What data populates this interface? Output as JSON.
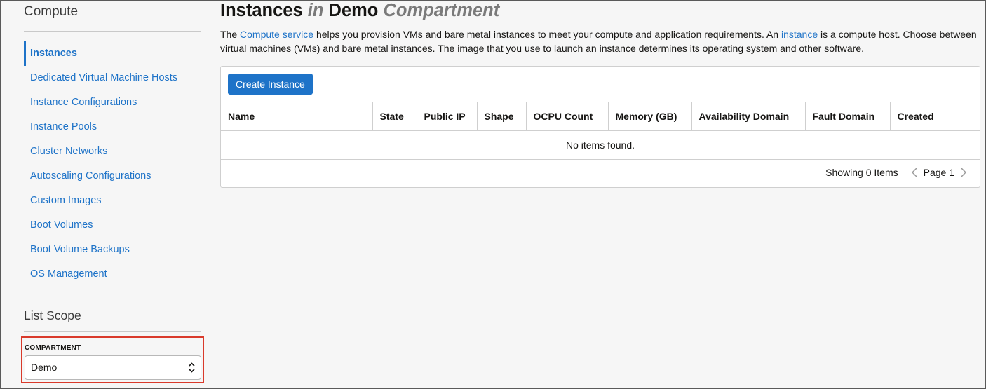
{
  "sidebar": {
    "title": "Compute",
    "items": [
      {
        "label": "Instances",
        "active": true
      },
      {
        "label": "Dedicated Virtual Machine Hosts"
      },
      {
        "label": "Instance Configurations"
      },
      {
        "label": "Instance Pools"
      },
      {
        "label": "Cluster Networks"
      },
      {
        "label": "Autoscaling Configurations"
      },
      {
        "label": "Custom Images"
      },
      {
        "label": "Boot Volumes"
      },
      {
        "label": "Boot Volume Backups"
      },
      {
        "label": "OS Management"
      }
    ],
    "scope_title": "List Scope",
    "compartment": {
      "label": "COMPARTMENT",
      "value": "Demo"
    }
  },
  "main": {
    "title": {
      "part1": "Instances",
      "part2": "in",
      "part3": "Demo",
      "part4": "Compartment"
    },
    "description": {
      "t1": "The ",
      "link1": "Compute service",
      "t2": " helps you provision VMs and bare metal instances to meet your compute and application requirements. An ",
      "link2": "instance",
      "t3": " is a compute host. Choose between virtual machines (VMs) and bare metal instances. The image that you use to launch an instance determines its operating system and other software."
    },
    "create_button": "Create Instance",
    "table": {
      "columns": [
        "Name",
        "State",
        "Public IP",
        "Shape",
        "OCPU Count",
        "Memory (GB)",
        "Availability Domain",
        "Fault Domain",
        "Created"
      ],
      "empty_message": "No items found."
    },
    "pager": {
      "showing": "Showing 0 Items",
      "page": "Page 1"
    }
  },
  "colors": {
    "accent": "#1e73c8",
    "highlight": "#d93a2b"
  }
}
